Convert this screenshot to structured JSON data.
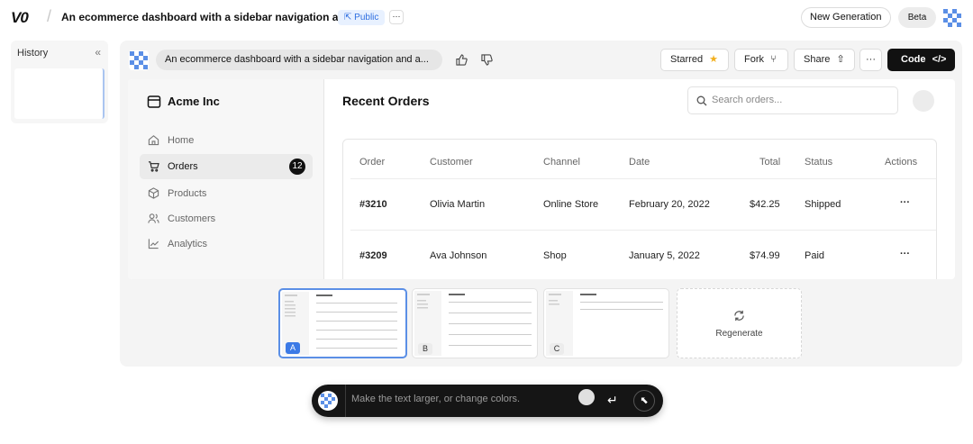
{
  "header": {
    "logo": "V0",
    "title": "An ecommerce dashboard with a sidebar navigation and...",
    "visibility": "Public",
    "more": "···",
    "new_generation": "New Generation",
    "beta": "Beta"
  },
  "history": {
    "title": "History",
    "collapse": "«"
  },
  "chat": {
    "prompt": "An ecommerce dashboard with a sidebar navigation and a...",
    "starred": "Starred",
    "fork": "Fork",
    "share": "Share",
    "more": "···",
    "code": "Code"
  },
  "preview": {
    "brand": "Acme Inc",
    "nav": [
      {
        "label": "Home"
      },
      {
        "label": "Orders",
        "badge": "12"
      },
      {
        "label": "Products"
      },
      {
        "label": "Customers"
      },
      {
        "label": "Analytics"
      }
    ],
    "page_title": "Recent Orders",
    "search_placeholder": "Search orders...",
    "columns": [
      "Order",
      "Customer",
      "Channel",
      "Date",
      "Total",
      "Status",
      "Actions"
    ],
    "rows": [
      {
        "order": "#3210",
        "customer": "Olivia Martin",
        "channel": "Online Store",
        "date": "February 20, 2022",
        "total": "$42.25",
        "status": "Shipped",
        "actions": "···"
      },
      {
        "order": "#3209",
        "customer": "Ava Johnson",
        "channel": "Shop",
        "date": "January 5, 2022",
        "total": "$74.99",
        "status": "Paid",
        "actions": "···"
      }
    ]
  },
  "variants": [
    {
      "label": "A",
      "selected": true
    },
    {
      "label": "B",
      "selected": false
    },
    {
      "label": "C",
      "selected": false
    }
  ],
  "regenerate": "Regenerate",
  "input": {
    "placeholder": "Make the text larger, or change colors."
  },
  "colors": {
    "accent": "#3c7ae6",
    "dark": "#111111",
    "public_badge": "#2f6fe0"
  }
}
